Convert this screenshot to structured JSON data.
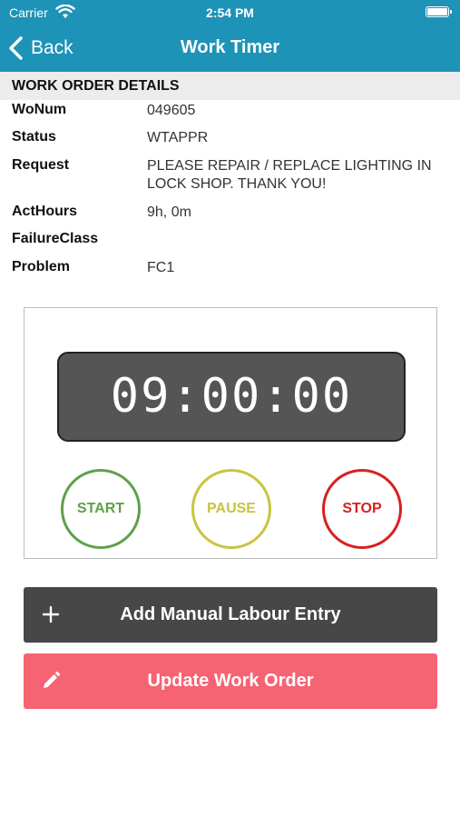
{
  "status_bar": {
    "carrier": "Carrier",
    "time": "2:54 PM"
  },
  "nav": {
    "back_label": "Back",
    "title": "Work Timer"
  },
  "section": {
    "title": "WORK ORDER DETAILS"
  },
  "details": [
    {
      "label": "WoNum",
      "value": "049605"
    },
    {
      "label": "Status",
      "value": "WTAPPR"
    },
    {
      "label": "Request",
      "value": "PLEASE REPAIR / REPLACE LIGHTING IN LOCK SHOP.  THANK YOU!"
    },
    {
      "label": "ActHours",
      "value": "9h, 0m"
    },
    {
      "label": "FailureClass",
      "value": ""
    },
    {
      "label": "Problem",
      "value": "FC1"
    }
  ],
  "timer": {
    "display": "09:00:00",
    "start_label": "START",
    "pause_label": "PAUSE",
    "stop_label": "STOP"
  },
  "actions": {
    "add_label": "Add Manual Labour Entry",
    "update_label": "Update Work Order"
  },
  "colors": {
    "nav_bg": "#1e93b8",
    "start": "#5fa04a",
    "pause": "#c9c440",
    "stop": "#d91f1f",
    "add_btn": "#474747",
    "update_btn": "#f66373"
  },
  "icons": {
    "wifi": "wifi-icon",
    "battery": "battery-icon",
    "back": "chevron-left-icon",
    "add": "plus-icon",
    "update": "pencil-icon"
  }
}
